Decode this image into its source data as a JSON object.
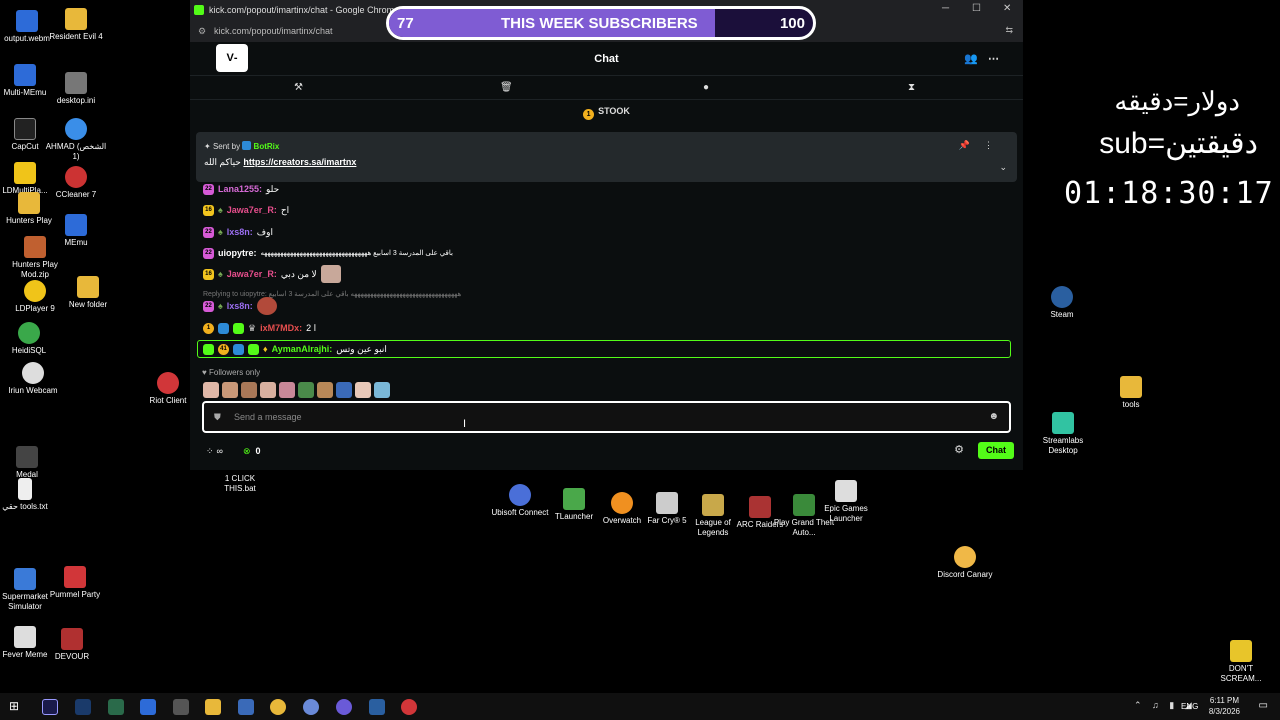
{
  "desktop_icons_left": [
    {
      "label": "output.webm",
      "color": "#2d6bd8"
    },
    {
      "label": "Resident Evil 4",
      "color": "#e8b83a"
    },
    {
      "label": "Multi-MEmu",
      "color": "#2d6bd8"
    },
    {
      "label": "desktop.ini",
      "color": "#777777"
    },
    {
      "label": "CapCut",
      "color": "#222222"
    },
    {
      "label": "AHMAD (الشخص 1)",
      "color": "#3a8ee8"
    },
    {
      "label": "LDMultiPla...",
      "color": "#f0c419"
    },
    {
      "label": "CCleaner 7",
      "color": "#cc3333"
    },
    {
      "label": "Hunters Play",
      "color": "#e8b83a"
    },
    {
      "label": "MEmu",
      "color": "#2d6bd8"
    },
    {
      "label": "Hunters Play Mod.zip",
      "color": "#c06030"
    },
    {
      "label": "LDPlayer 9",
      "color": "#f0c419"
    },
    {
      "label": "New folder",
      "color": "#e8b83a"
    },
    {
      "label": "HeidiSQL",
      "color": "#3aa84a"
    },
    {
      "label": "Iriun Webcam",
      "color": "#dddddd"
    },
    {
      "label": "Riot Client",
      "color": "#d13639"
    },
    {
      "label": "Medal",
      "color": "#444444"
    },
    {
      "label": "حقي tools.txt",
      "color": "#eeeeee"
    },
    {
      "label": "1 CLICK THIS.bat",
      "color": "#444444"
    },
    {
      "label": "Supermarket Simulator",
      "color": "#3a7ad8"
    },
    {
      "label": "Pummel Party",
      "color": "#d13639"
    },
    {
      "label": "Fever Meme",
      "color": "#dddddd"
    },
    {
      "label": "DEVOUR",
      "color": "#b03030"
    },
    {
      "label": "Steam",
      "color": "#2a5fa0"
    },
    {
      "label": "tools",
      "color": "#e8b83a"
    },
    {
      "label": "Streamlabs Desktop",
      "color": "#31c3a2"
    },
    {
      "label": "Discord Canary",
      "color": "#f0b847"
    },
    {
      "label": "DON'T SCREAM...",
      "color": "#e8c52a"
    }
  ],
  "dock_icons": [
    {
      "label": "Ubisoft Connect",
      "color": "#4a6fd8"
    },
    {
      "label": "TLauncher",
      "color": "#4aa84a"
    },
    {
      "label": "Overwatch",
      "color": "#f09020"
    },
    {
      "label": "Far Cry® 5",
      "color": "#cccccc"
    },
    {
      "label": "League of Legends",
      "color": "#c8a84a"
    },
    {
      "label": "ARC Raiders",
      "color": "#aa3333"
    },
    {
      "label": "Play Grand Theft Auto...",
      "color": "#3a8a3a"
    },
    {
      "label": "Epic Games Launcher",
      "color": "#dddddd"
    }
  ],
  "browser": {
    "title": "kick.com/popout/imartinx/chat - Google Chrome",
    "url": "kick.com/popout/imartinx/chat"
  },
  "chat": {
    "header_title": "Chat",
    "logo_text": "V‐",
    "pinned_label": "STOOK",
    "pinned_count": "1",
    "pinned_sent_by": "Sent by",
    "pinned_bot": "BotRix",
    "pinned_message_prefix": "حياكم الله",
    "pinned_link": "https://creators.sa/imartnx",
    "messages": [
      {
        "user": "Lana1255:",
        "text": "حلو",
        "color": "#d66ad6",
        "badge": "22",
        "badge_color": "#d65ad6"
      },
      {
        "user": "Jawa7er_R:",
        "text": "اح",
        "color": "#e64e8c",
        "badge": "16",
        "badge_color": "#f2c51e"
      },
      {
        "user": "lxs8n:",
        "text": "اوف",
        "color": "#9a6ef0",
        "badge": "22",
        "badge_color": "#d65ad6"
      },
      {
        "user": "uiopytre:",
        "text": "باقي على المدرسة 3 اسابيع هههههههههههههههههههههههههههههههههه",
        "color": "#ffffff",
        "badge": "22",
        "badge_color": "#d65ad6"
      },
      {
        "user": "Jawa7er_R:",
        "text": "لا من دبي",
        "color": "#e64e8c",
        "badge": "16",
        "badge_color": "#f2c51e"
      },
      {
        "user": "lxs8n:",
        "text": "",
        "color": "#9a6ef0",
        "badge": "22",
        "badge_color": "#d65ad6"
      },
      {
        "user": "ixM7MDx:",
        "text": "2 ا",
        "color": "#e64e4e",
        "badge": "1",
        "badge_color": "#f2b01e"
      },
      {
        "user": "AymanAlrajhi:",
        "text": "انبو عين وتس",
        "color": "#53fc18",
        "badge": "41",
        "badge_color": "#53fc18"
      }
    ],
    "reply_text": "Replying to uiopytre: هههههههههههههههههههههههههههههههههه باقي على المدرسة 3 اسابيع",
    "followers_only": "Followers only",
    "input_placeholder": "Send a message",
    "viewer_count": "0",
    "chat_button": "Chat",
    "infinity": "∞"
  },
  "sub_goal": {
    "current": "77",
    "label": "THIS WEEK SUBSCRIBERS",
    "target": "100",
    "progress": 0.77
  },
  "overlay": {
    "line1": "دولار=دقيقه",
    "line2": "sub=دقيقتين",
    "timer": "01:18:30:17"
  },
  "taskbar": {
    "lang": "ENG",
    "time": "6:11 PM",
    "date": "8/3/2026"
  }
}
